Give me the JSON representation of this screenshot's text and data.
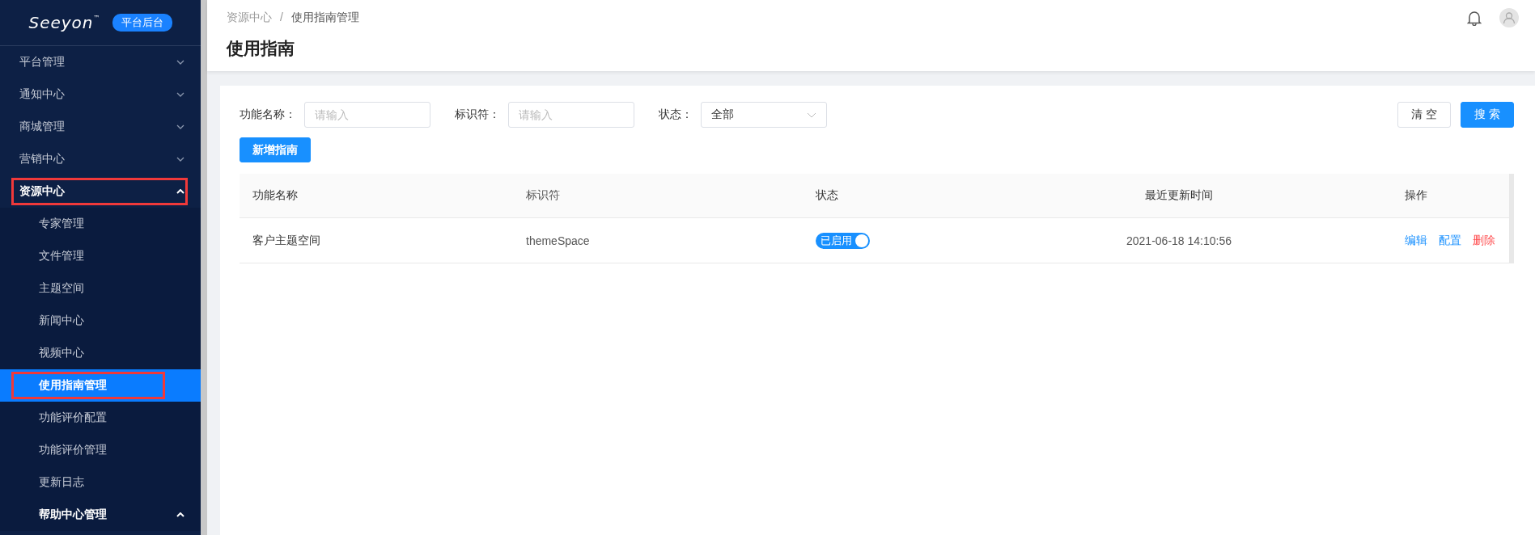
{
  "logo": {
    "text": "Seeyon",
    "mark": "™",
    "badge": "平台后台"
  },
  "sidebar": {
    "items": [
      {
        "label": "平台管理",
        "expanded": false,
        "selected": false,
        "highlighted": false
      },
      {
        "label": "通知中心",
        "expanded": false,
        "selected": false,
        "highlighted": false
      },
      {
        "label": "商城管理",
        "expanded": false,
        "selected": false,
        "highlighted": false
      },
      {
        "label": "营销中心",
        "expanded": false,
        "selected": false,
        "highlighted": false
      },
      {
        "label": "资源中心",
        "expanded": true,
        "selected": false,
        "highlighted": true,
        "children": [
          {
            "label": "专家管理",
            "selected": false,
            "highlighted": false
          },
          {
            "label": "文件管理",
            "selected": false,
            "highlighted": false
          },
          {
            "label": "主题空间",
            "selected": false,
            "highlighted": false
          },
          {
            "label": "新闻中心",
            "selected": false,
            "highlighted": false
          },
          {
            "label": "视频中心",
            "selected": false,
            "highlighted": false
          },
          {
            "label": "使用指南管理",
            "selected": true,
            "highlighted": true
          },
          {
            "label": "功能评价配置",
            "selected": false,
            "highlighted": false
          },
          {
            "label": "功能评价管理",
            "selected": false,
            "highlighted": false
          },
          {
            "label": "更新日志",
            "selected": false,
            "highlighted": false
          },
          {
            "label": "帮助中心管理",
            "selected": false,
            "highlighted": false,
            "expanded": true
          }
        ]
      }
    ]
  },
  "breadcrumb": {
    "items": [
      "资源中心",
      "使用指南管理"
    ],
    "separator": "/"
  },
  "page_title": "使用指南",
  "filters": [
    {
      "kind": "input",
      "label": "功能名称：",
      "placeholder": "请输入"
    },
    {
      "kind": "input",
      "label": "标识符：",
      "placeholder": "请输入"
    },
    {
      "kind": "select",
      "label": "状态：",
      "value": "全部"
    }
  ],
  "filter_buttons": [
    {
      "label": "清 空",
      "primary": false
    },
    {
      "label": "搜 索",
      "primary": true
    }
  ],
  "add_button": "新增指南",
  "table": {
    "columns": [
      "功能名称",
      "标识符",
      "状态",
      "最近更新时间",
      "操作"
    ],
    "rows": [
      {
        "name": "客户主题空间",
        "key": "themeSpace",
        "status": {
          "label": "已启用",
          "on": true
        },
        "updated": "2021-06-18 14:10:56",
        "actions": [
          {
            "label": "编辑",
            "danger": false
          },
          {
            "label": "配置",
            "danger": false
          },
          {
            "label": "删除",
            "danger": true
          }
        ]
      }
    ]
  }
}
